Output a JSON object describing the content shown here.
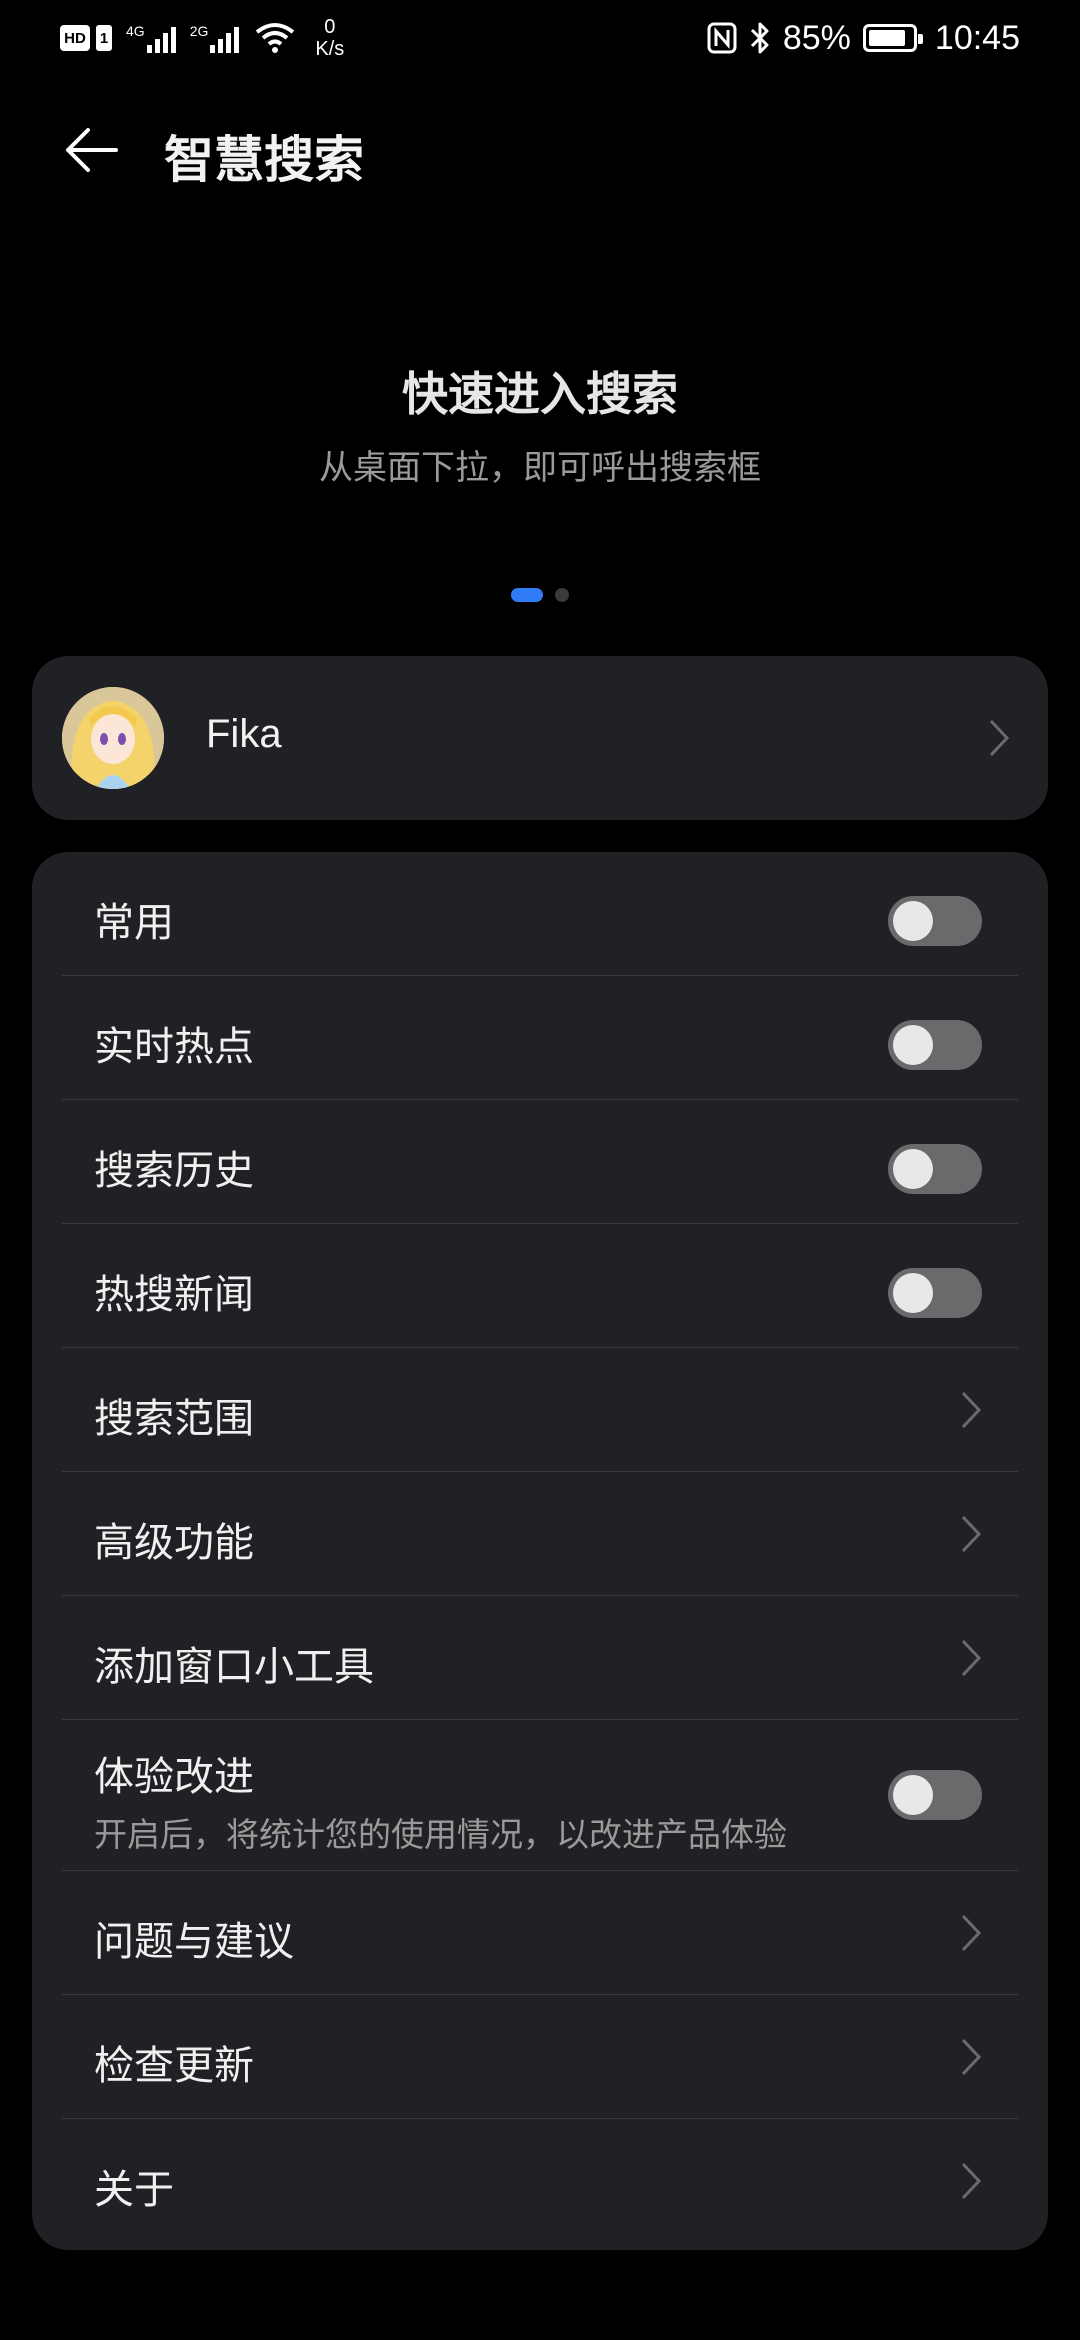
{
  "status_bar": {
    "hd": "HD",
    "sim": "1",
    "net1": "4G",
    "net2": "2G",
    "speed_value": "0",
    "speed_unit": "K/s",
    "battery": "85%",
    "battery_level": 0.85,
    "time": "10:45"
  },
  "header": {
    "title": "智慧搜索"
  },
  "banner": {
    "title": "快速进入搜索",
    "subtitle": "从桌面下拉，即可呼出搜索框",
    "page_index": 1,
    "page_count": 2
  },
  "profile": {
    "name": "Fika"
  },
  "settings": [
    {
      "label": "常用",
      "type": "toggle",
      "on": false
    },
    {
      "label": "实时热点",
      "type": "toggle",
      "on": false
    },
    {
      "label": "搜索历史",
      "type": "toggle",
      "on": false
    },
    {
      "label": "热搜新闻",
      "type": "toggle",
      "on": false
    },
    {
      "label": "搜索范围",
      "type": "link"
    },
    {
      "label": "高级功能",
      "type": "link"
    },
    {
      "label": "添加窗口小工具",
      "type": "link"
    },
    {
      "label": "体验改进",
      "sublabel": "开启后，将统计您的使用情况，以改进产品体验",
      "type": "toggle",
      "on": false
    },
    {
      "label": "问题与建议",
      "type": "link"
    },
    {
      "label": "检查更新",
      "type": "link"
    },
    {
      "label": "关于",
      "type": "link"
    }
  ],
  "colors": {
    "accent": "#2f7cf6",
    "card": "#202124",
    "background": "#000000",
    "toggle_off": "#6a6a6c"
  }
}
